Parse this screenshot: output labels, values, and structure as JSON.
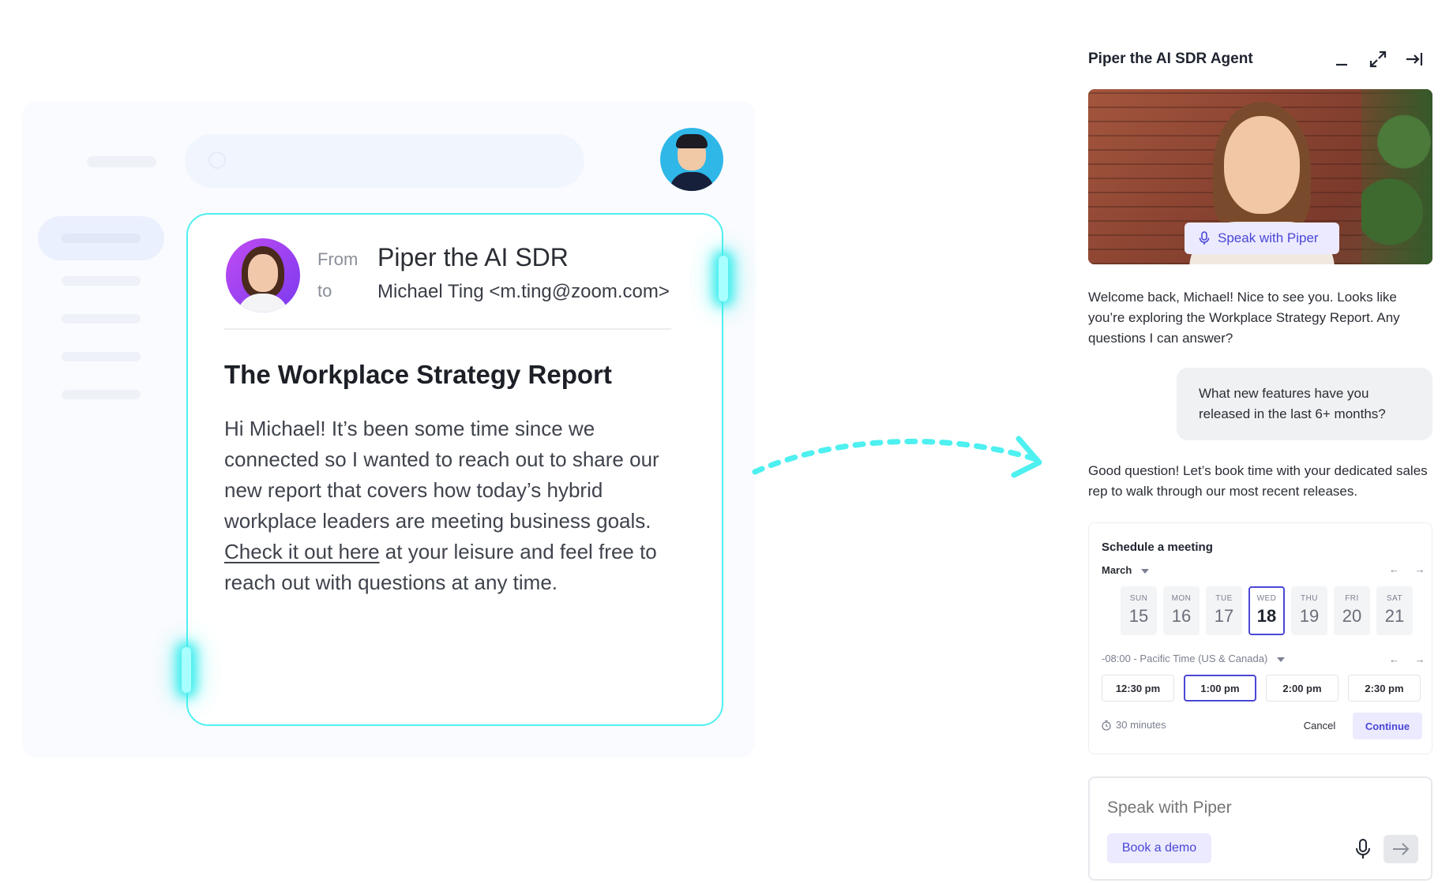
{
  "email": {
    "from_label": "From",
    "to_label": "to",
    "sender_name": "Piper the AI SDR",
    "recipient": "Michael Ting <m.ting@zoom.com>",
    "title": "The Workplace Strategy Report",
    "body_before_link": "Hi Michael! It’s been some time since we connected so I wanted to reach out to share our new report that covers how today’s hybrid workplace leaders are meeting business goals. ",
    "link_text": "Check it out here",
    "body_after_link": " at your leisure and feel free to reach out with questions at any time."
  },
  "agent_panel": {
    "title": "Piper the AI SDR Agent",
    "video_chip": "Speak with Piper",
    "messages": {
      "agent_1": "Welcome back, Michael! Nice to see you. Looks like you’re exploring the Workplace Strategy Report. Any questions I can answer?",
      "user_1": "What new features have you released in the last 6+ months?",
      "agent_2": "Good question! Let’s book time with your dedicated sales rep to walk through our most recent releases."
    },
    "scheduler": {
      "title": "Schedule a meeting",
      "month": "March",
      "nav_arrows": "← →",
      "days": [
        {
          "name": "SUN",
          "date": "15"
        },
        {
          "name": "MON",
          "date": "16"
        },
        {
          "name": "TUE",
          "date": "17"
        },
        {
          "name": "WED",
          "date": "18"
        },
        {
          "name": "THU",
          "date": "19"
        },
        {
          "name": "FRI",
          "date": "20"
        },
        {
          "name": "SAT",
          "date": "21"
        }
      ],
      "selected_day": "18",
      "timezone": "-08:00 - Pacific Time (US & Canada)",
      "slots": [
        "12:30 pm",
        "1:00 pm",
        "2:00 pm",
        "2:30 pm"
      ],
      "selected_slot": "1:00 pm",
      "duration": "30 minutes",
      "cancel": "Cancel",
      "continue": "Continue"
    },
    "composer": {
      "placeholder": "Speak with Piper",
      "demo_button": "Book a demo"
    }
  },
  "colors": {
    "accent": "#4a47d6",
    "accent_bg": "#eceaff",
    "card_glow": "#4ef0f0"
  },
  "icons": [
    "search-icon",
    "minimize-icon",
    "expand-icon",
    "collapse-panel-icon",
    "microphone-icon",
    "clock-icon",
    "send-arrow-icon",
    "dashed-arrow"
  ]
}
